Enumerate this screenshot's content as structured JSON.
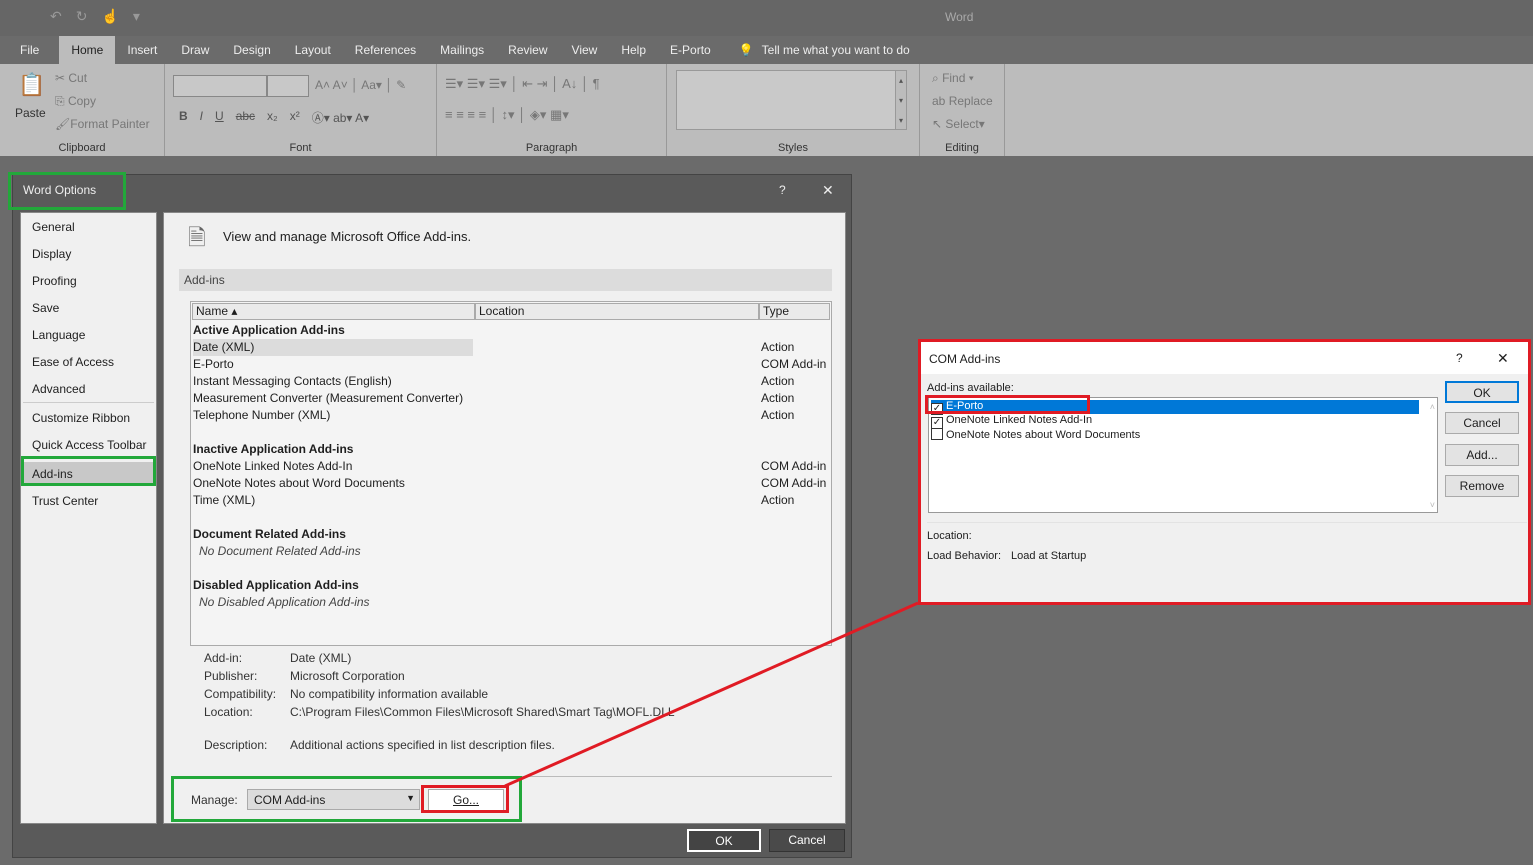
{
  "app": {
    "title": "Word"
  },
  "tabs": [
    "File",
    "Home",
    "Insert",
    "Draw",
    "Design",
    "Layout",
    "References",
    "Mailings",
    "Review",
    "View",
    "Help",
    "E-Porto"
  ],
  "tell_me": "Tell me what you want to do",
  "ribbon": {
    "clipboard": {
      "label": "Clipboard",
      "paste": "Paste",
      "cut": "Cut",
      "copy": "Copy",
      "format_painter": "Format Painter"
    },
    "font": {
      "label": "Font",
      "buttons": [
        "B",
        "I",
        "U",
        "abc",
        "x₂",
        "x²"
      ]
    },
    "paragraph": {
      "label": "Paragraph"
    },
    "styles": {
      "label": "Styles"
    },
    "editing": {
      "label": "Editing",
      "find": "Find",
      "replace": "Replace",
      "select": "Select"
    }
  },
  "options": {
    "title": "Word Options",
    "help": "?",
    "close": "✕",
    "sidebar": [
      "General",
      "Display",
      "Proofing",
      "Save",
      "Language",
      "Ease of Access",
      "Advanced",
      "Customize Ribbon",
      "Quick Access Toolbar",
      "Add-ins",
      "Trust Center"
    ],
    "heading": "View and manage Microsoft Office Add-ins.",
    "section": "Add-ins",
    "columns": [
      "Name ▴",
      "Location",
      "Type"
    ],
    "groups": [
      {
        "title": "Active Application Add-ins",
        "items": [
          [
            "Date (XML)",
            "Action"
          ],
          [
            "E-Porto",
            "COM Add-in"
          ],
          [
            "Instant Messaging Contacts (English)",
            "Action"
          ],
          [
            "Measurement Converter (Measurement Converter)",
            "Action"
          ],
          [
            "Telephone Number (XML)",
            "Action"
          ]
        ]
      },
      {
        "title": "Inactive Application Add-ins",
        "items": [
          [
            "OneNote Linked Notes Add-In",
            "COM Add-in"
          ],
          [
            "OneNote Notes about Word Documents",
            "COM Add-in"
          ],
          [
            "Time (XML)",
            "Action"
          ]
        ]
      },
      {
        "title": "Document Related Add-ins",
        "empty": "No Document Related Add-ins"
      },
      {
        "title": "Disabled Application Add-ins",
        "empty": "No Disabled Application Add-ins"
      }
    ],
    "details": [
      [
        "Add-in:",
        "Date (XML)"
      ],
      [
        "Publisher:",
        "Microsoft Corporation"
      ],
      [
        "Compatibility:",
        "No compatibility information available"
      ],
      [
        "Location:",
        "C:\\Program Files\\Common Files\\Microsoft Shared\\Smart Tag\\MOFL.DLL"
      ],
      [
        "Description:",
        "Additional actions specified in list description files."
      ]
    ],
    "manage_label": "Manage:",
    "manage_value": "COM Add-ins",
    "go": "Go...",
    "ok": "OK",
    "cancel": "Cancel"
  },
  "com": {
    "title": "COM Add-ins",
    "help": "?",
    "close": "✕",
    "available_label": "Add-ins available:",
    "items": [
      {
        "label": "E-Porto",
        "checked": true
      },
      {
        "label": "OneNote Linked Notes Add-In",
        "checked": true
      },
      {
        "label": "OneNote Notes about Word Documents",
        "checked": false
      }
    ],
    "ok": "OK",
    "cancel": "Cancel",
    "add": "Add...",
    "remove": "Remove",
    "location_label": "Location:",
    "load_label": "Load Behavior:",
    "load_value": "Load at Startup"
  },
  "colors": {
    "highlight_green": "#22a83a",
    "highlight_red": "#e01b24",
    "selection": "#0078d7"
  }
}
